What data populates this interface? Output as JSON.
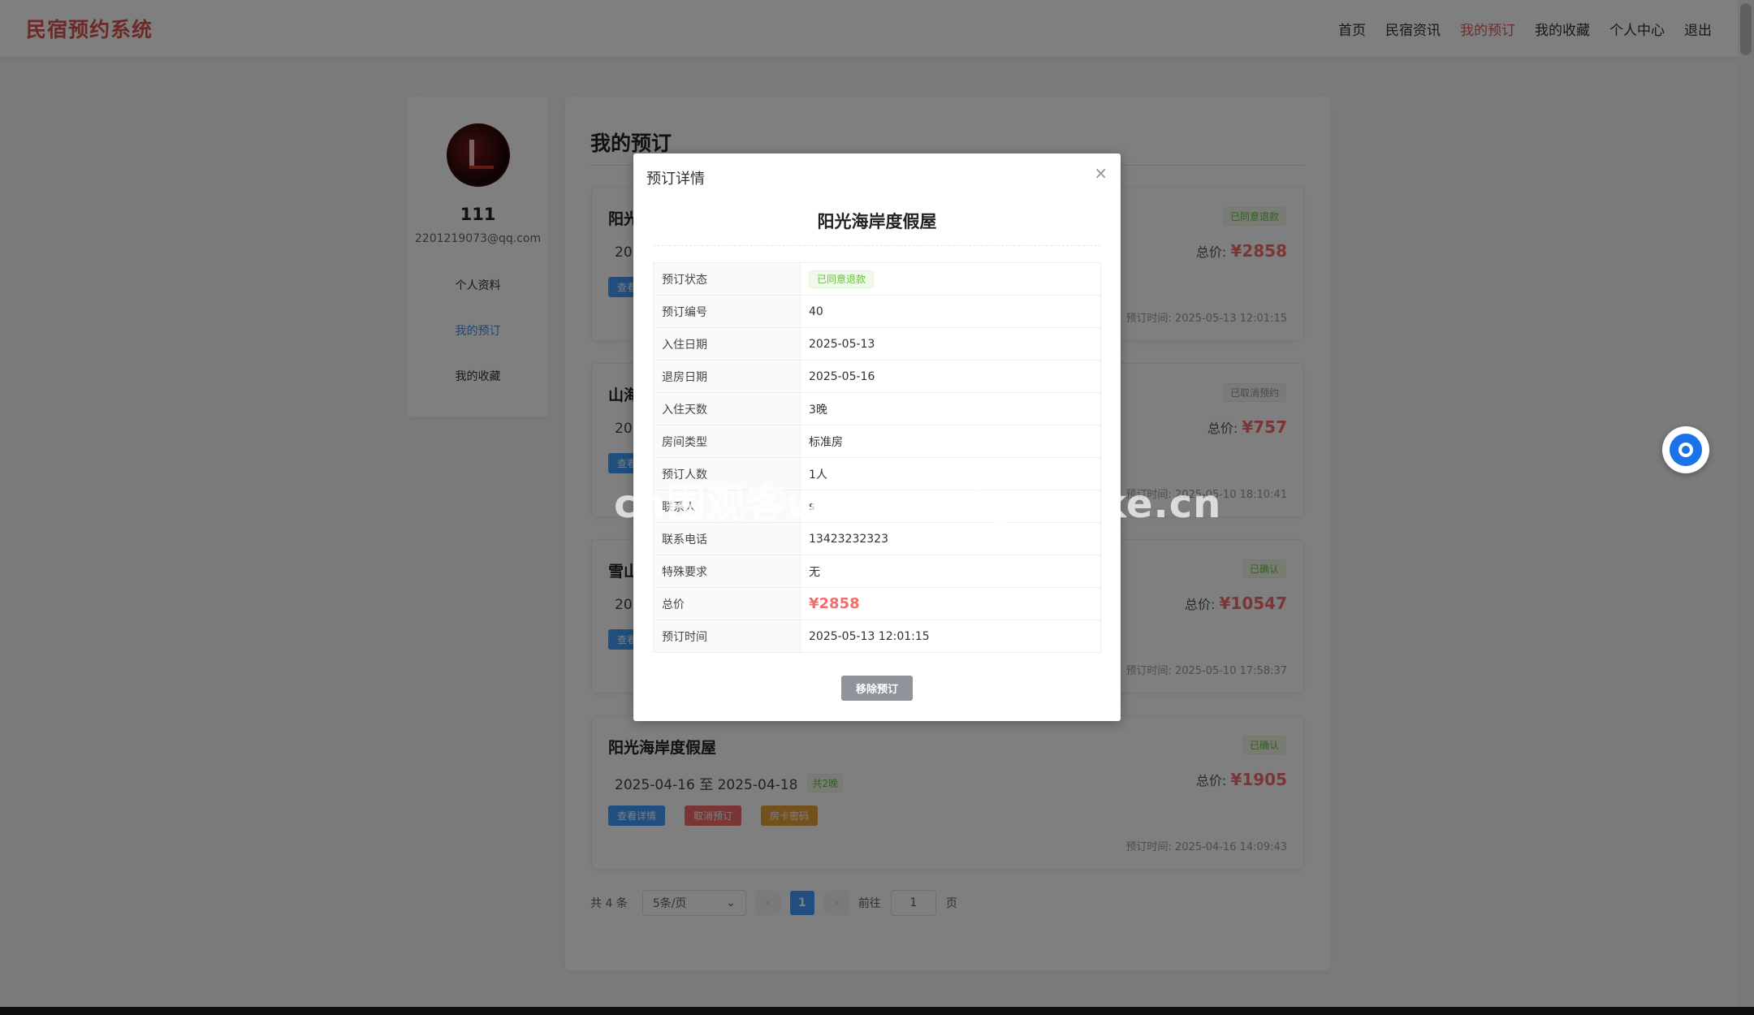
{
  "brand": "民宿预约系统",
  "nav": [
    "首页",
    "民宿资讯",
    "我的预订",
    "我的收藏",
    "个人中心",
    "退出"
  ],
  "nav_active": "我的预订",
  "user": {
    "name": "111",
    "email": "2201219073@qq.com"
  },
  "side_menu": [
    "个人资料",
    "我的预订",
    "我的收藏"
  ],
  "main_title": "我的预订",
  "orders": [
    {
      "name": "阳光",
      "dates": "202",
      "nights": "",
      "status": "已同意退款",
      "price": "¥2858",
      "time": "预订时间: 2025-05-13 12:01:15",
      "buttons": [
        "查看详情"
      ]
    },
    {
      "name": "山海",
      "dates": "202",
      "nights": "",
      "status": "已取消预约",
      "price": "¥757",
      "time": "预订时间: 2025-05-10 18:10:41",
      "buttons": [
        "查看详情"
      ]
    },
    {
      "name": "雪山",
      "dates": "202",
      "nights": "",
      "status": "已确认",
      "price": "¥10547",
      "time": "预订时间: 2025-05-10 17:58:37",
      "buttons": [
        "查看详情"
      ]
    },
    {
      "name": "阳光海岸度假屋",
      "dates": "2025-04-16 至 2025-04-18",
      "nights": "共2晚",
      "status": "已确认",
      "price": "¥1905",
      "time": "预订时间: 2025-04-16 14:09:43",
      "buttons": [
        "查看详情",
        "取消预订",
        "房卡密码"
      ]
    }
  ],
  "price_label": "总价:",
  "pager": {
    "total": "共 4 条",
    "size": "5条/页",
    "current": "1",
    "goto": "前往",
    "goto_value": "1",
    "page_unit": "页"
  },
  "dialog": {
    "title": "预订详情",
    "close": "×",
    "heading": "阳光海岸度假屋",
    "rows": [
      {
        "label": "预订状态",
        "value": "已同意退款"
      },
      {
        "label": "预订编号",
        "value": "40"
      },
      {
        "label": "入住日期",
        "value": "2025-05-13"
      },
      {
        "label": "退房日期",
        "value": "2025-05-16"
      },
      {
        "label": "入住天数",
        "value": "3晚"
      },
      {
        "label": "房间类型",
        "value": "标准房"
      },
      {
        "label": "预订人数",
        "value": "1人"
      },
      {
        "label": "联系人",
        "value": "s"
      },
      {
        "label": "联系电话",
        "value": "13423232323"
      },
      {
        "label": "特殊要求",
        "value": "无"
      },
      {
        "label": "总价",
        "value": "¥2858"
      },
      {
        "label": "预订时间",
        "value": "2025-05-13 12:01:15"
      }
    ],
    "remove_button": "移除预订"
  },
  "watermark": "cn围观客www.weiguanke.cn",
  "colors": {
    "brand": "#d9534f",
    "accent": "#409eff",
    "price": "#f56c6c",
    "success": "#67c23a"
  }
}
